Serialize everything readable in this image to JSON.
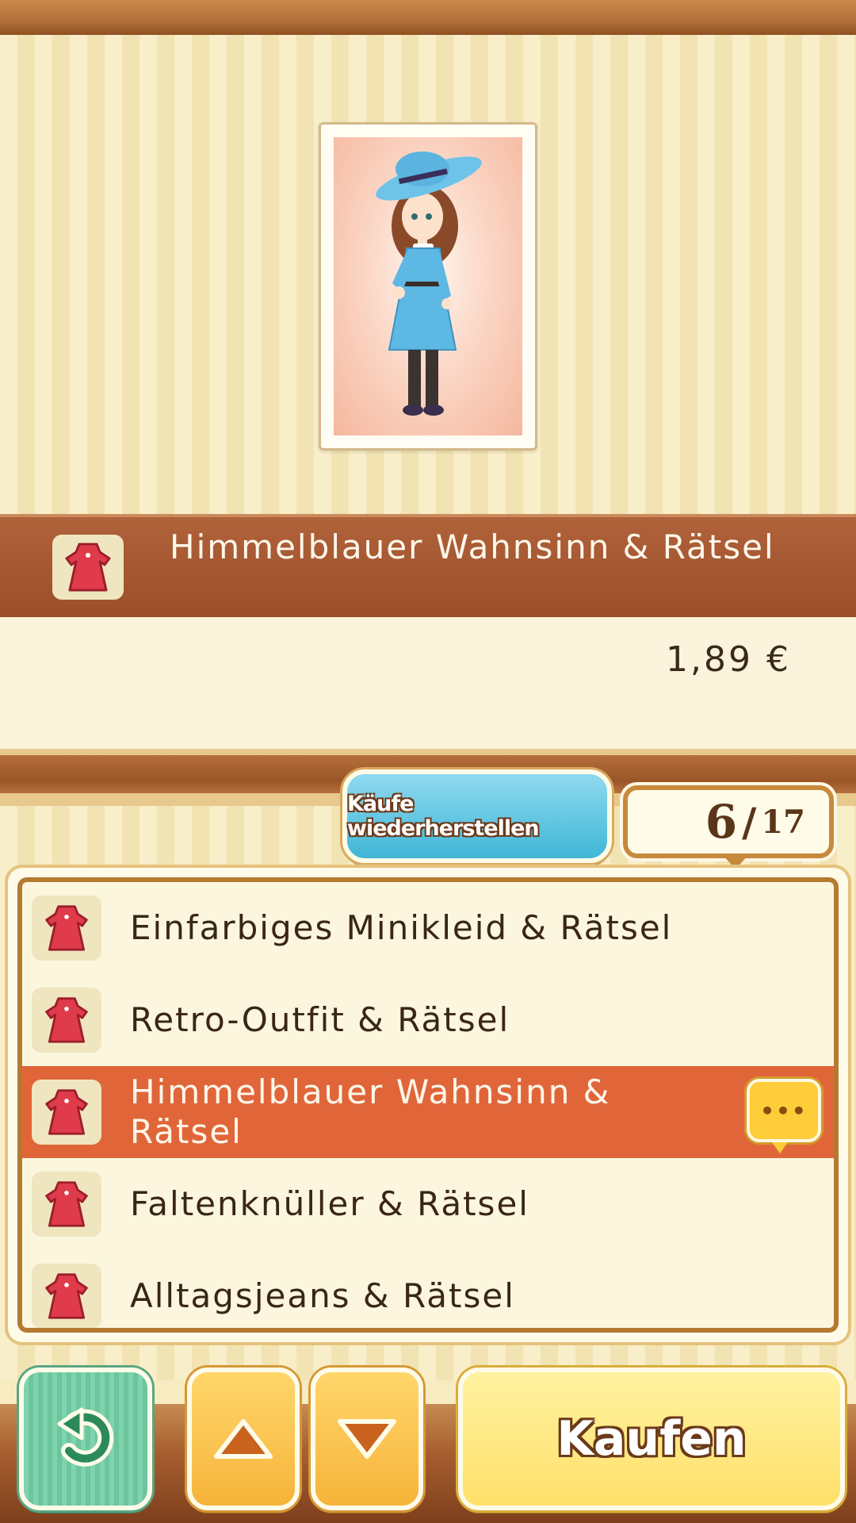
{
  "selected_item": {
    "name": "Himmelblauer Wahnsinn & Rätsel",
    "price": "1,89 €"
  },
  "restore_button": {
    "label": "Käufe wiederherstellen"
  },
  "counter": {
    "current": "6",
    "separator": "/",
    "total": "17"
  },
  "list": {
    "items": [
      {
        "label": "Einfarbiges Minikleid & Rätsel",
        "icon": "dress-icon"
      },
      {
        "label": "Retro-Outfit & Rätsel",
        "icon": "dress-icon"
      },
      {
        "label": "Himmelblauer Wahnsinn & Rätsel",
        "icon": "dress-icon",
        "selected": true,
        "badge": "chat-bubble-icon"
      },
      {
        "label": "Faltenknüller & Rätsel",
        "icon": "dress-icon"
      },
      {
        "label": "Alltagsjeans & Rätsel",
        "icon": "dress-icon"
      }
    ]
  },
  "buttons": {
    "back_icon": "back-arrow-icon",
    "up_icon": "arrow-up-icon",
    "down_icon": "arrow-down-icon",
    "buy_label": "Kaufen"
  },
  "colors": {
    "title_bar": "#9a4e2a",
    "selected_row": "#e0663a",
    "restore_button": "#40b6d6",
    "back_button": "#7fd3ae",
    "arrow_buttons": "#f6b43a",
    "buy_button": "#ffe06a"
  }
}
